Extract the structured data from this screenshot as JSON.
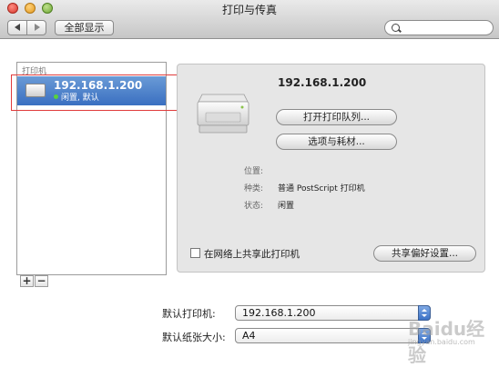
{
  "window": {
    "title": "打印与传真"
  },
  "toolbar": {
    "show_all_label": "全部显示",
    "search_placeholder": ""
  },
  "printer_list": {
    "header": "打印机",
    "items": [
      {
        "name": "192.168.1.200",
        "status": "闲置, 默认"
      }
    ]
  },
  "detail": {
    "printer_name": "192.168.1.200",
    "open_queue_label": "打开打印队列...",
    "options_label": "选项与耗材...",
    "location_label": "位置:",
    "location_value": "",
    "kind_label": "种类:",
    "kind_value": "普通 PostScript 打印机",
    "status_label": "状态:",
    "status_value": "闲置",
    "share_label": "在网络上共享此打印机",
    "share_checked": false,
    "share_prefs_label": "共享偏好设置..."
  },
  "list_controls": {
    "add_label": "+",
    "remove_label": "−"
  },
  "defaults": {
    "default_printer_label": "默认打印机:",
    "default_printer_value": "192.168.1.200",
    "default_paper_label": "默认纸张大小:",
    "default_paper_value": "A4"
  },
  "watermark": {
    "text": "Baidu经验",
    "url": "jingyan.baidu.com"
  },
  "colors": {
    "selection": "#3a6fc1",
    "highlight_box": "#e03b3b",
    "status_dot": "#58d23c"
  }
}
